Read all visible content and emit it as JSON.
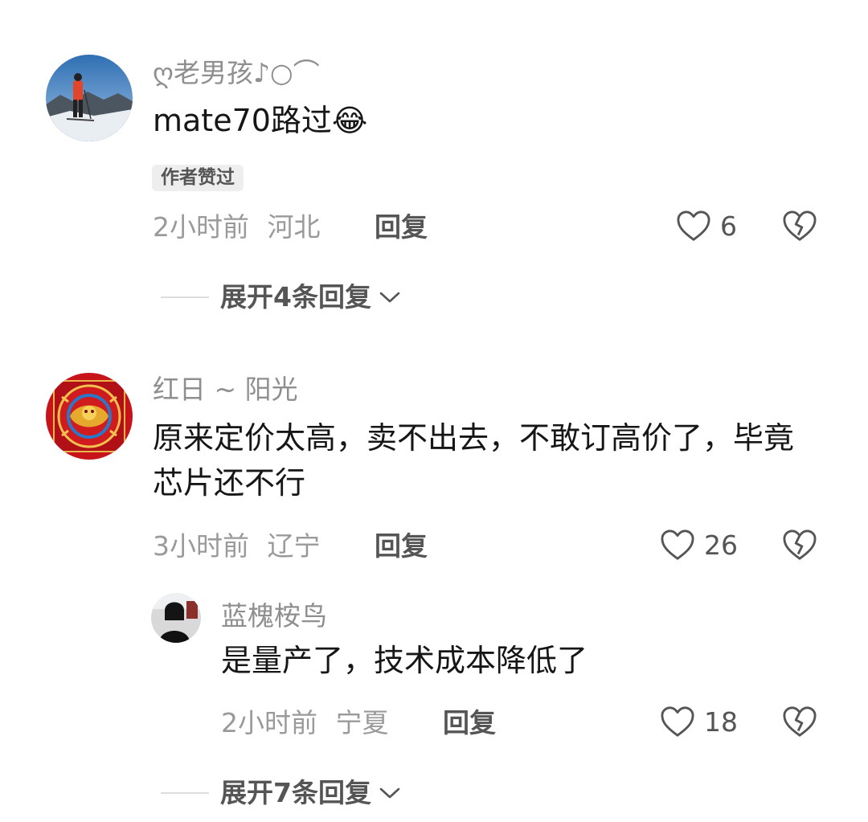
{
  "comments": [
    {
      "username": "ღ老男孩♪○⌒",
      "content": "mate70路过😂",
      "badge": "作者赞过",
      "time": "2小时前",
      "location": "河北",
      "reply_label": "回复",
      "likes": "6",
      "expand_label": "展开4条回复"
    },
    {
      "username": "红日 ~ 阳光",
      "content": "原来定价太高，卖不出去，不敢订高价了，毕竟芯片还不行",
      "time": "3小时前",
      "location": "辽宁",
      "reply_label": "回复",
      "likes": "26",
      "replies": [
        {
          "username": "蓝槐桉鸟",
          "content": "是量产了，技术成本降低了",
          "time": "2小时前",
          "location": "宁夏",
          "reply_label": "回复",
          "likes": "18"
        }
      ],
      "expand_label": "展开7条回复"
    }
  ],
  "icons": {
    "like": "heart-outline-icon",
    "dislike": "broken-heart-icon",
    "expand": "chevron-down-icon"
  },
  "colors": {
    "username": "#8f8f8f",
    "text": "#161616",
    "meta": "#9a9a9a",
    "action": "#555555",
    "badge_bg": "#eeeeee"
  }
}
